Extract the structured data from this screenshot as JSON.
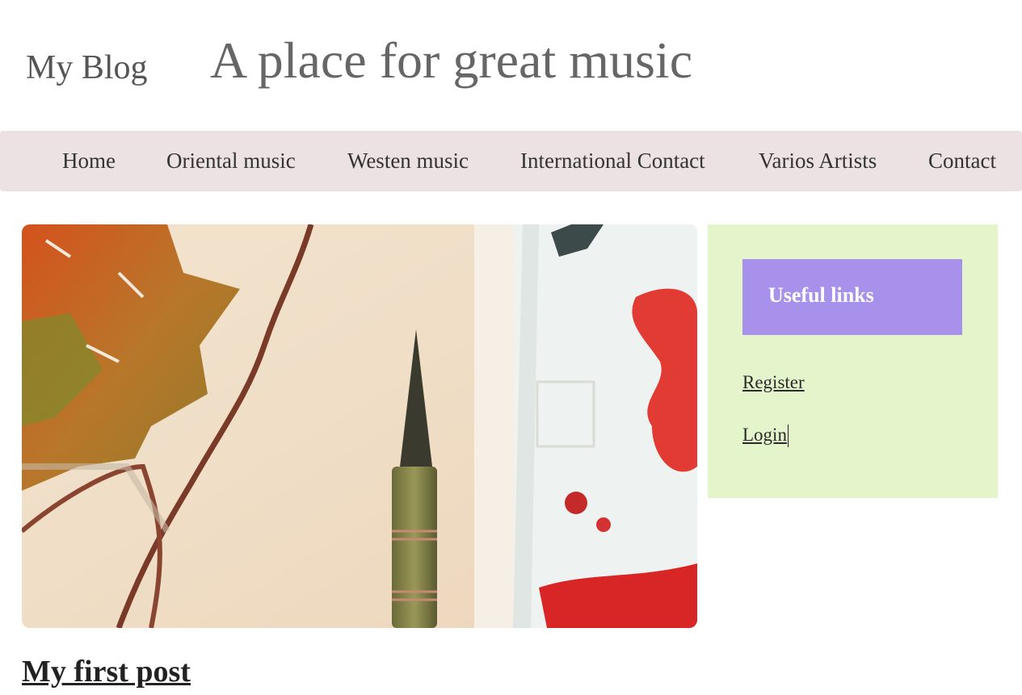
{
  "header": {
    "site_name": "My Blog",
    "tagline": "A place for great music"
  },
  "nav": {
    "items": [
      {
        "label": "Home"
      },
      {
        "label": "Oriental music"
      },
      {
        "label": "Westen music"
      },
      {
        "label": "International Contact"
      },
      {
        "label": "Varios Artists"
      },
      {
        "label": "Contact"
      }
    ]
  },
  "hero": {
    "image_subject": "watercolor painting of autumn leaf with paintbrush and red paint palette"
  },
  "sidebar": {
    "widget_title": "Useful links",
    "links": [
      {
        "label": "Register"
      },
      {
        "label": "Login"
      }
    ]
  },
  "post": {
    "title": "My first post"
  },
  "colors": {
    "nav_background": "#ede2e3",
    "sidebar_background": "#e4f5cb",
    "widget_title_background": "#a791ea",
    "heading_text": "#666666"
  }
}
